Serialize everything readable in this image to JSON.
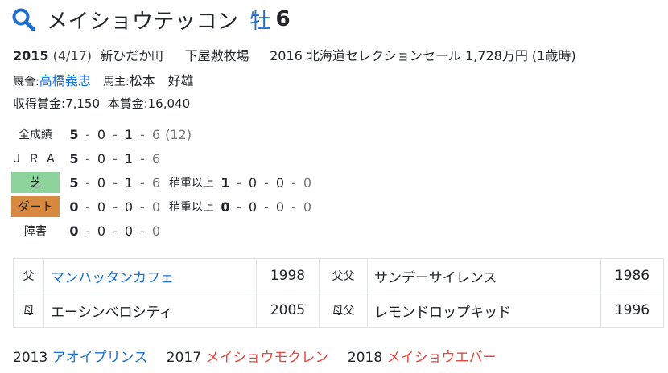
{
  "horse": {
    "name": "メイショウテッコン",
    "sex_label": "牡",
    "age": "6"
  },
  "profile": {
    "birth_year": "2015",
    "birth_date": "(4/17)",
    "birthplace": "新ひだか町",
    "breeder": "下屋敷牧場",
    "sale": "2016 北海道セレクションセール 1,728万円 (1歳時)",
    "trainer_label": "厩舎:",
    "trainer": "高橋義忠",
    "owner_label": "馬主:",
    "owner": "松本　好雄",
    "earnings_label": "収得賞金:",
    "earnings": "7,150",
    "prize_label": "本賞金:",
    "prize": "16,040"
  },
  "records": {
    "total": {
      "label": "全成績",
      "w": "5",
      "p2": "0",
      "p3": "1",
      "other": "6",
      "starts": "(12)"
    },
    "jra": {
      "label": "ＪＲＡ",
      "w": "5",
      "p2": "0",
      "p3": "1",
      "other": "6"
    },
    "turf": {
      "label": "芝",
      "w": "5",
      "p2": "0",
      "p3": "1",
      "other": "6",
      "heavy_label": "稍重以上",
      "hw": "1",
      "hp2": "0",
      "hp3": "0",
      "hother": "0"
    },
    "dirt": {
      "label": "ダート",
      "w": "0",
      "p2": "0",
      "p3": "0",
      "other": "0",
      "heavy_label": "稍重以上",
      "hw": "0",
      "hp2": "0",
      "hp3": "0",
      "hother": "0"
    },
    "steeple": {
      "label": "障害",
      "w": "0",
      "p2": "0",
      "p3": "0",
      "other": "0"
    }
  },
  "pedigree": {
    "sire_label": "父",
    "sire": "マンハッタンカフェ",
    "sire_year": "1998",
    "sire_sire_label": "父父",
    "sire_sire": "サンデーサイレンス",
    "sire_sire_year": "1986",
    "dam_label": "母",
    "dam": "エーシンベロシティ",
    "dam_year": "2005",
    "dam_sire_label": "母父",
    "dam_sire": "レモンドロップキッド",
    "dam_sire_year": "1996"
  },
  "offspring": [
    {
      "year": "2013",
      "name": "アオイプリンス",
      "color": "#1e6fd0"
    },
    {
      "year": "2017",
      "name": "メイショウモクレン",
      "color": "#e8453c"
    },
    {
      "year": "2018",
      "name": "メイショウエバー",
      "color": "#e8453c"
    }
  ],
  "colors": {
    "link": "#1e6fd0",
    "red": "#e8453c",
    "turf_badge": "#8fd39c",
    "dirt_badge": "#d9883f"
  }
}
